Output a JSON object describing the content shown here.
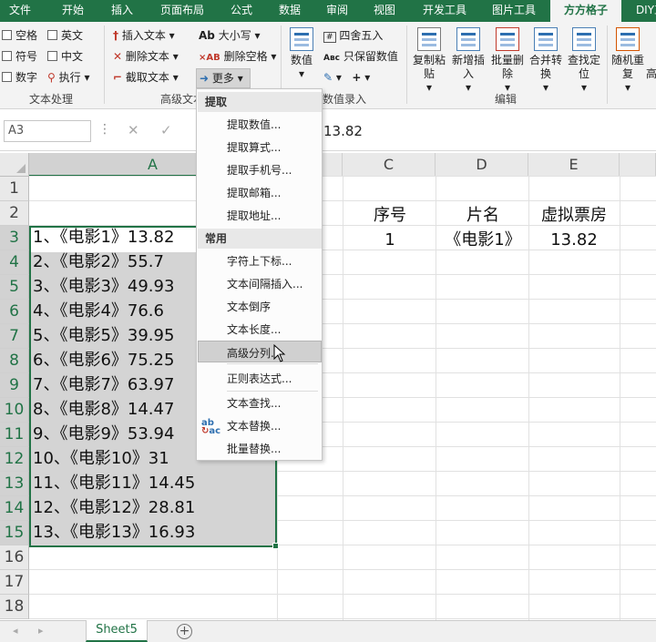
{
  "tabs": [
    "文件",
    "开始",
    "插入",
    "页面布局",
    "公式",
    "数据",
    "审阅",
    "视图",
    "开发工具",
    "图片工具",
    "方方格子",
    "DIY工"
  ],
  "ribbon": {
    "checks": [
      "空格",
      "英文",
      "符号",
      "中文",
      "数字"
    ],
    "execute": "执行",
    "text_group": "文本处理",
    "insert_text": "插入文本",
    "delete_text": "删除文本",
    "cut_text": "截取文本",
    "advanced_group": "高级文本",
    "case": "大小写",
    "delete_space": "删除空格",
    "more": "更多",
    "value": "数值",
    "round": "四舍五入",
    "keep_value": "只保留数值",
    "plus": "+",
    "value_input_group": "数值录入",
    "copy_paste": "复制粘贴",
    "new_insert": "新增插入",
    "batch_delete": "批量删除",
    "merge_convert": "合并转换",
    "find_locate": "查找定位",
    "edit_group": "编辑",
    "random_repeat": "随机重复",
    "high": "高"
  },
  "formula_bar": {
    "name_box": "A3",
    "value": "13.82"
  },
  "columns": [
    "A",
    "C",
    "D",
    "E"
  ],
  "rows": [
    "1",
    "2",
    "3",
    "4",
    "5",
    "6",
    "7",
    "8",
    "9",
    "10",
    "11",
    "12",
    "13",
    "14",
    "15",
    "16",
    "17",
    "18"
  ],
  "colA": [
    "1、《电影1》13.82",
    "2、《电影2》55.7",
    "3、《电影3》49.93",
    "4、《电影4》76.6",
    "5、《电影5》39.95",
    "6、《电影6》75.25",
    "7、《电影7》63.97",
    "8、《电影8》14.47",
    "9、《电影9》53.94",
    "10、《电影10》31",
    "11、《电影11》14.45",
    "12、《电影12》28.81",
    "13、《电影13》16.93"
  ],
  "headers": {
    "c": "序号",
    "d": "片名",
    "e": "虚拟票房"
  },
  "row3": {
    "c": "1",
    "d": "《电影1》",
    "e": "13.82"
  },
  "menu": {
    "extract_head": "提取",
    "extract_items": [
      "提取数值...",
      "提取算式...",
      "提取手机号...",
      "提取邮箱...",
      "提取地址..."
    ],
    "common_head": "常用",
    "common_items": [
      "字符上下标...",
      "文本间隔插入...",
      "文本倒序",
      "文本长度...",
      "高级分列...",
      "正则表达式...",
      "文本查找...",
      "文本替换...",
      "批量替换..."
    ]
  },
  "sheet_tab": "Sheet5",
  "accent": "#217346"
}
